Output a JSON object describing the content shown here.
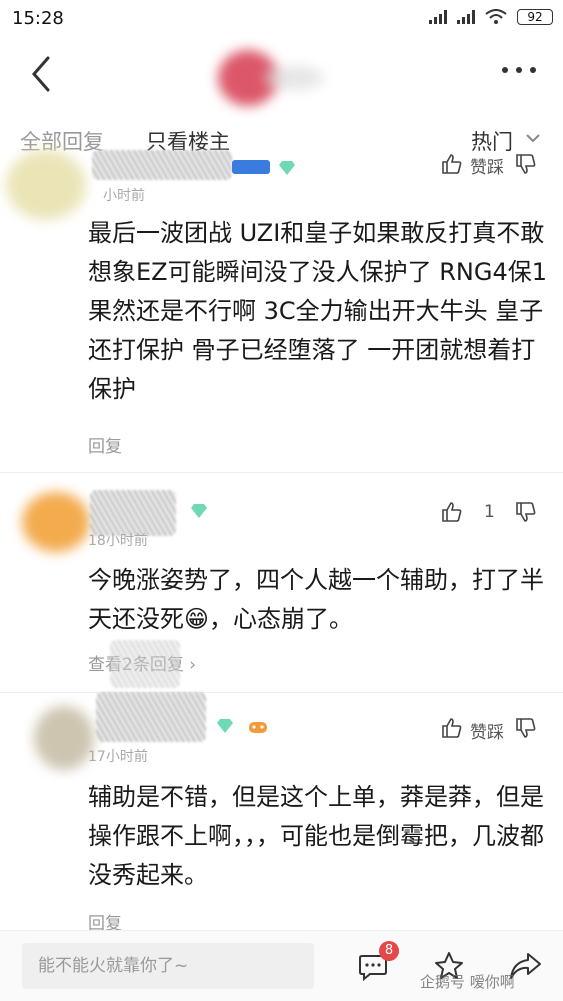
{
  "status": {
    "time": "15:28",
    "battery": "92"
  },
  "filter": {
    "all_label": "全部回复",
    "op_only_label": "只看楼主",
    "sort_label": "热门"
  },
  "comments": [
    {
      "time": "小时前",
      "action_label": "赞踩",
      "text": "最后一波团战 UZI和皇子如果敢反打真不敢想象EZ可能瞬间没了没人保护了 RNG4保1果然还是不行啊 3C全力输出开大牛头 皇子还打保护 骨子已经堕落了 一开团就想着打保护",
      "reply_label": "回复"
    },
    {
      "time": "18小时前",
      "like_count": "1",
      "text_before_emoji": "今晚涨姿势了，四个人越一个辅助，打了半天还没死",
      "emoji": "😁",
      "text_after_emoji": "，心态崩了。",
      "view_replies_label": "查看2条回复",
      "view_replies_chevron": "›"
    },
    {
      "time": "17小时前",
      "action_label": "赞踩",
      "text": "辅助是不错，但是这个上单，莽是莽，但是操作跟不上啊，，，可能也是倒霉把，几波都没秀起来。",
      "reply_label": "回复"
    }
  ],
  "bottom_bar": {
    "input_placeholder": "能不能火就靠你了~",
    "message_badge": "8",
    "watermark": "企鹅号 嗳你啊"
  },
  "icons": [
    "back-arrow-icon",
    "more-icon",
    "chevron-down-icon",
    "thumb-up-icon",
    "thumb-down-icon",
    "diamond-icon",
    "comment-icon",
    "star-icon",
    "share-icon"
  ]
}
